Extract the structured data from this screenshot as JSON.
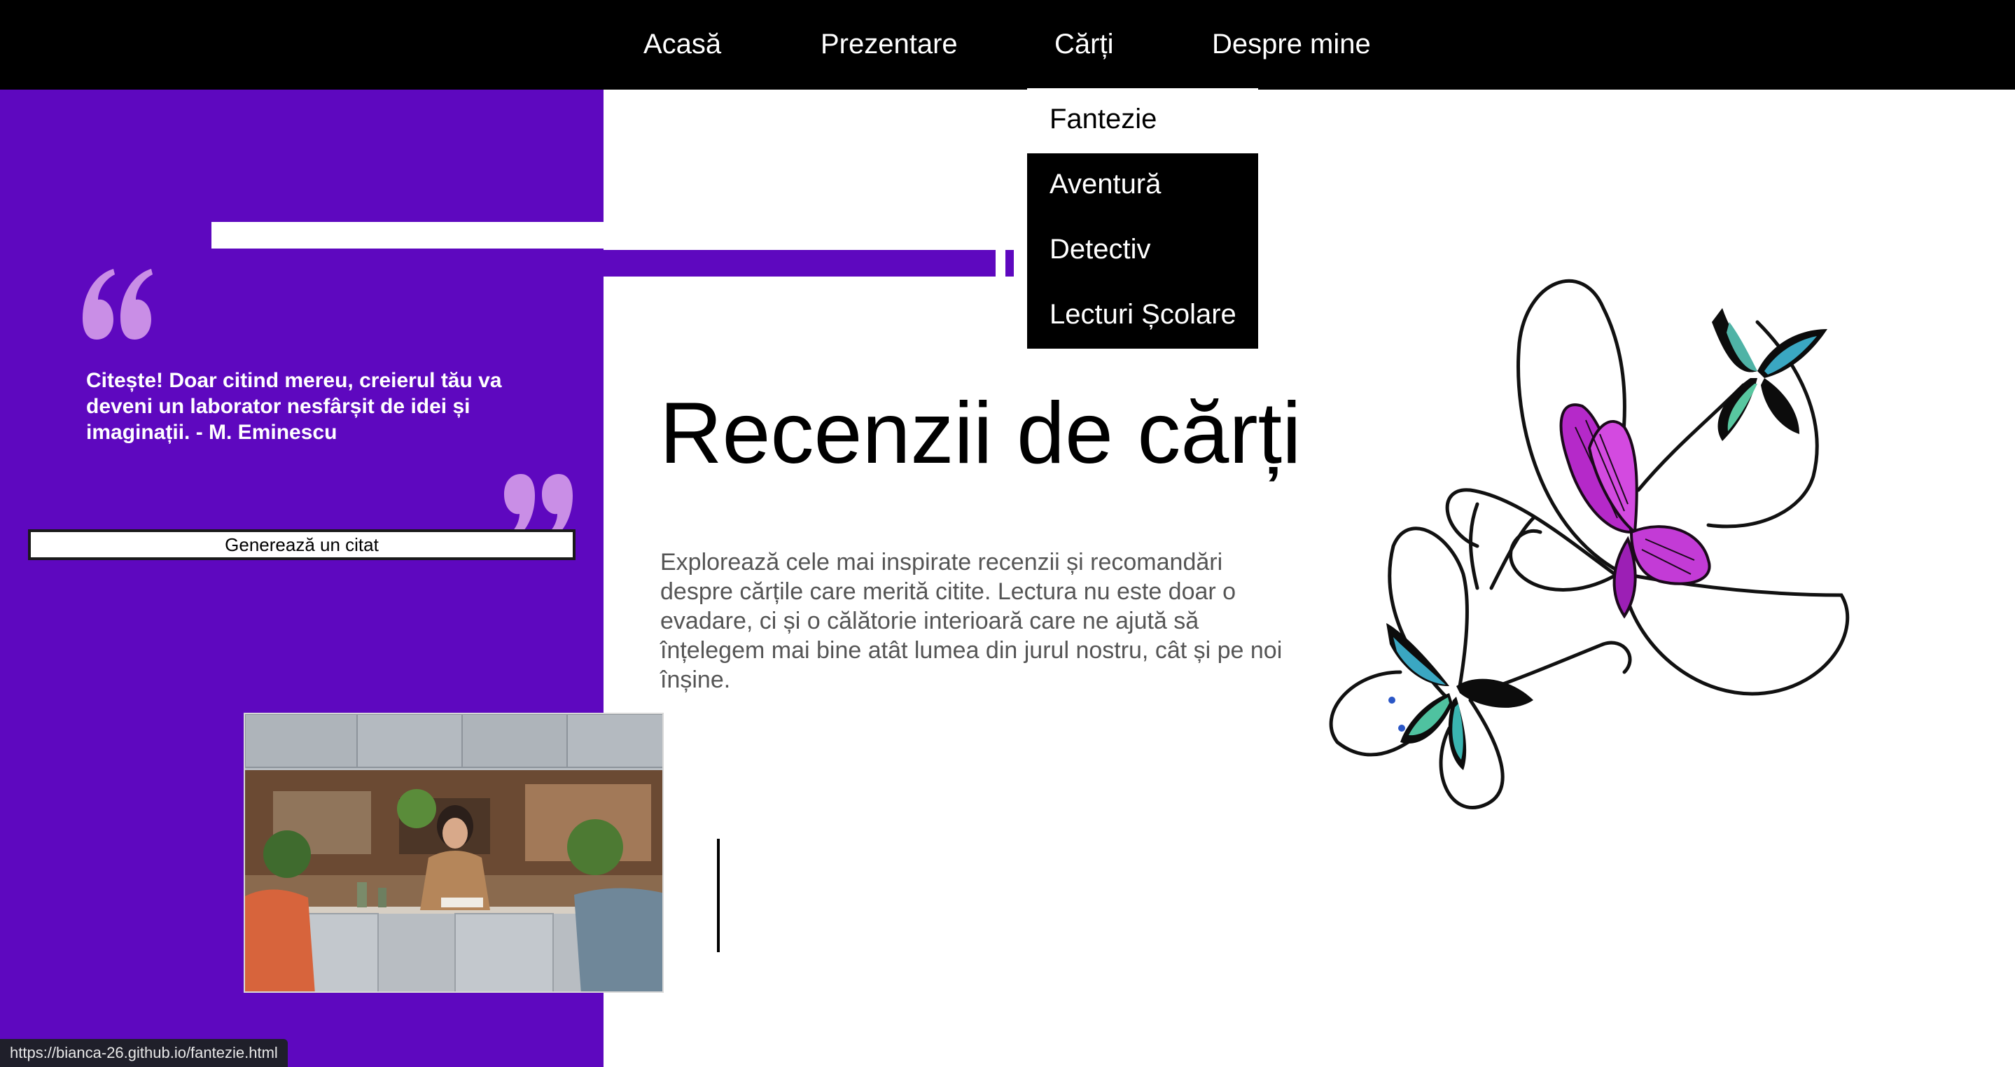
{
  "nav": {
    "links": [
      {
        "label": "Acasă"
      },
      {
        "label": "Prezentare"
      },
      {
        "label": "Cărți"
      },
      {
        "label": "Despre mine"
      }
    ],
    "dropdown": [
      {
        "label": "Fantezie",
        "hovered": true
      },
      {
        "label": "Aventură"
      },
      {
        "label": "Detectiv"
      },
      {
        "label": "Lecturi Școlare"
      }
    ]
  },
  "sidebar": {
    "quote": "Citește! Doar citind mereu, creierul tău va deveni un laborator nesfârșit de idei și imaginații. - M. Eminescu",
    "button_label": "Generează un citat",
    "quote_icon_color": "#c98ee6",
    "panel_color": "#5e08bf"
  },
  "main": {
    "title": "Recenzii de cărți",
    "description": "Explorează cele mai inspirate recenzii și recomandări despre cărțile care merită citite. Lectura nu este doar o evadare, ci și o călătorie interioară care ne ajută să înțelegem mai bine atât lumea din jurul nostru, cât și pe noi înșine."
  },
  "status_bar": {
    "url": "https://bianca-26.github.io/fantezie.html"
  },
  "icons": {
    "open_quote": "open-quote-icon",
    "close_quote": "close-quote-icon",
    "butterflies": "butterflies-illustration"
  }
}
